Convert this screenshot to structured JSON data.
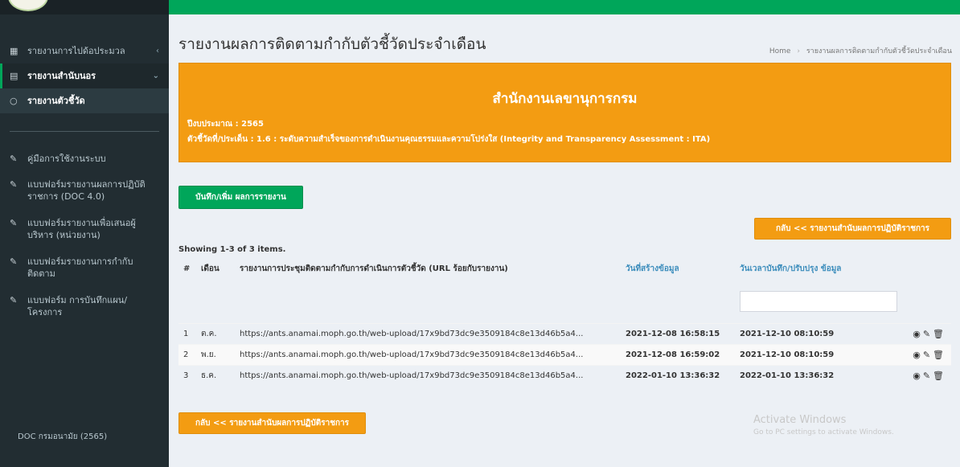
{
  "sidebar": {
    "items": [
      {
        "icon": "table-icon",
        "label": "รายงานการไปด้อประมวล",
        "chevron": "‹"
      },
      {
        "icon": "file-icon",
        "label": "รายงานสำนับนอร",
        "chevron": "⌄"
      },
      {
        "icon": "circle-icon",
        "label": "รายงานตัวชี้วัด"
      },
      {
        "icon": "book-icon",
        "label": "คู่มือการใช้งานระบบ"
      },
      {
        "icon": "book-icon",
        "label": "แบบฟอร์มรายงานผลการปฏิบัติราชการ (DOC 4.0)"
      },
      {
        "icon": "book-icon",
        "label": "แบบฟอร์มรายงานเพื่อเสนอผู้บริหาร (หน่วยงาน)"
      },
      {
        "icon": "book-icon",
        "label": "แบบฟอร์มรายงานการกำกับติดตาม"
      },
      {
        "icon": "book-icon",
        "label": "แบบฟอร์ม การบันทึกแผน/โครงการ"
      }
    ],
    "bottom_label": "DOC กรมอนามัย (2565)"
  },
  "page": {
    "title": "รายงานผลการติดตามกำกับตัวชี้วัดประจำเดือน",
    "breadcrumb_home": "Home",
    "breadcrumb_current": "รายงานผลการติดตามกำกับตัวชี้วัดประจำเดือน"
  },
  "banner": {
    "title": "สำนักงานเลขานุการกรม",
    "year_line": "ปีงบประมาณ : 2565",
    "indicator_line": "ตัวชี้วัดที่/ประเด็น : 1.6 : ระดับความสำเร็จของการดำเนินงานคุณธรรมและความโปร่งใส (Integrity and Transparency Assessment : ITA)"
  },
  "buttons": {
    "add_result": "บันทึก/เพิ่ม ผลการรายงาน",
    "back_top": "กลับ << รายงานสำนับผลการปฏิบัติราชการ",
    "back_bottom": "กลับ << รายงานสำนับผลการปฏิบัติราชการ"
  },
  "table": {
    "summary": "Showing 1-3 of 3 items.",
    "headers": {
      "num": "#",
      "month": "เดือน",
      "report": "รายงานการประชุมติดตามกำกับการดำเนินการตัวชี้วัด (URL ร้อยกับรายงาน)",
      "created": "วันที่สร้างข้อมูล",
      "updated": "วันเวลาบันทึก/ปรับปรุง ข้อมูล"
    },
    "rows": [
      {
        "num": "1",
        "month": "ต.ค.",
        "url": "https://ants.anamai.moph.go.th/web-upload/17x9bd73dc9e3509184c8e13d46b5a4...",
        "created": "2021-12-08 16:58:15",
        "updated": "2021-12-10 08:10:59"
      },
      {
        "num": "2",
        "month": "พ.ย.",
        "url": "https://ants.anamai.moph.go.th/web-upload/17x9bd73dc9e3509184c8e13d46b5a4...",
        "created": "2021-12-08 16:59:02",
        "updated": "2021-12-10 08:10:59"
      },
      {
        "num": "3",
        "month": "ธ.ค.",
        "url": "https://ants.anamai.moph.go.th/web-upload/17x9bd73dc9e3509184c8e13d46b5a4...",
        "created": "2022-01-10 13:36:32",
        "updated": "2022-01-10 13:36:32"
      }
    ],
    "action_icons": {
      "view": "◉",
      "edit": "✎",
      "delete": "🗑"
    }
  },
  "watermark": {
    "line1": "Activate Windows",
    "line2": "Go to PC settings to activate Windows."
  },
  "colors": {
    "topbar": "#00a65a",
    "sidebar": "#222d32",
    "banner": "#f39c12",
    "link": "#3c8dbc"
  }
}
